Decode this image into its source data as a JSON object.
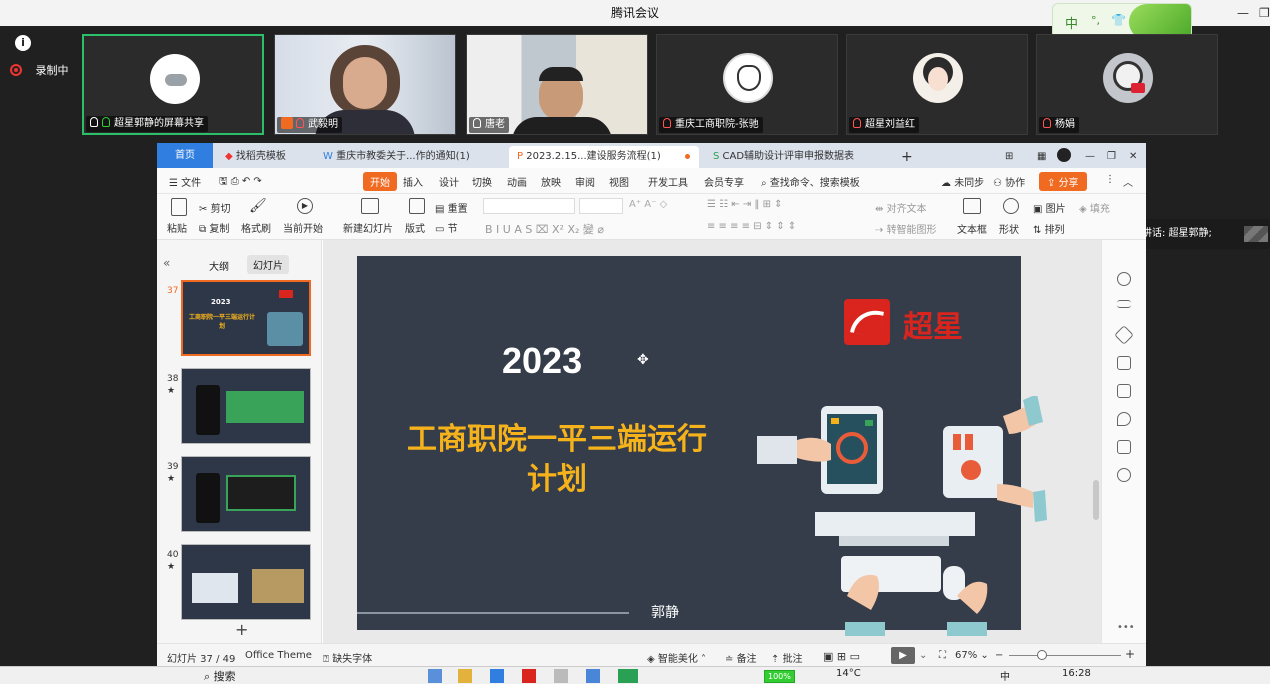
{
  "meeting": {
    "title": "腾讯会议",
    "recording_label": "录制中",
    "participants": [
      {
        "name": "超星郭静的屏幕共享",
        "active": true
      },
      {
        "name": "武毅明",
        "active": false
      },
      {
        "name": "唐老",
        "active": false
      },
      {
        "name": "重庆工商职院-张驰",
        "active": false
      },
      {
        "name": "超星刘益红",
        "active": false
      },
      {
        "name": "杨娟",
        "active": false
      }
    ],
    "speaking": "正在讲话: 超星郭静;",
    "ime": "中"
  },
  "wps": {
    "tabs": [
      {
        "label": "首页"
      },
      {
        "label": "找稻壳模板"
      },
      {
        "label": "重庆市教委关于...作的通知(1)"
      },
      {
        "label": "2023.2.15...建设服务流程(1)"
      },
      {
        "label": "CAD辅助设计评审申报数据表"
      }
    ],
    "menu": [
      "文件",
      "开始",
      "插入",
      "设计",
      "切换",
      "动画",
      "放映",
      "审阅",
      "视图",
      "开发工具",
      "会员专享"
    ],
    "search_placeholder": "查找命令、搜索模板",
    "sync": "未同步",
    "collab": "协作",
    "share": "分享",
    "toolbar": {
      "cut": "剪切",
      "paste": "粘贴",
      "copy": "复制",
      "format_painter": "格式刷",
      "from_current": "当前开始",
      "new_slide": "新建幻灯片",
      "layout": "版式",
      "section": "节",
      "reset": "重置",
      "align_text": "对齐文本",
      "smart_shape": "转智能图形",
      "textbox": "文本框",
      "shape": "形状",
      "picture": "图片",
      "fill": "填充",
      "arrange": "排列"
    },
    "pane_tabs": [
      "大纲",
      "幻灯片"
    ],
    "thumbs": [
      {
        "num": "37",
        "title": "2023",
        "subtitle": "工商职院一平三端运行计划"
      },
      {
        "num": "38"
      },
      {
        "num": "39"
      },
      {
        "num": "40"
      }
    ],
    "slide": {
      "year": "2023",
      "title_line1": "工商职院一平三端运行",
      "title_line2": "计划",
      "presenter": "郭静",
      "logo_text": "超星"
    },
    "status": {
      "slide_count": "幻灯片 37 / 49",
      "theme": "Office Theme",
      "missing_font": "缺失字体",
      "smart": "智能美化",
      "notes": "备注",
      "comments": "批注",
      "zoom": "67%"
    }
  },
  "taskbar": {
    "search": "搜索",
    "battery": "100%",
    "weather": "14°C",
    "time": "16:28",
    "ime": "中"
  },
  "colors": {
    "accent": "#f06a22",
    "slide_bg": "#353d4a",
    "slide_title": "#f6b21b",
    "logo": "#d9251d"
  }
}
